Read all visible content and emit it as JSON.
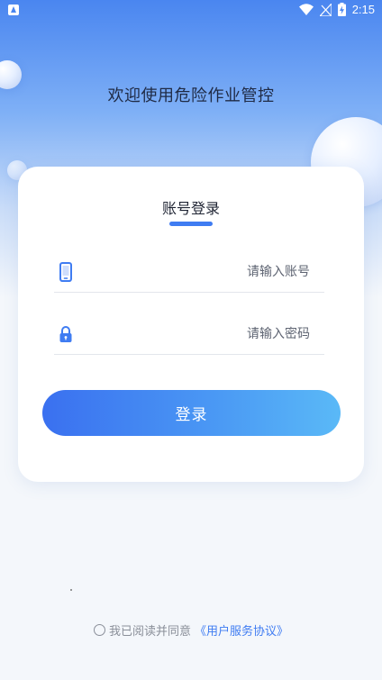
{
  "status_bar": {
    "time": "2:15",
    "icons": [
      "app-notification-icon",
      "wifi-icon",
      "signal-icon",
      "battery-charging-icon"
    ]
  },
  "welcome_text": "欢迎使用危险作业管控",
  "card": {
    "title": "账号登录"
  },
  "form": {
    "account": {
      "placeholder": "请输入账号",
      "icon": "phone-icon"
    },
    "password": {
      "placeholder": "请输入密码",
      "icon": "lock-icon"
    },
    "login_label": "登录"
  },
  "agreement": {
    "text": "我已阅读并同意",
    "link": "《用户服务协议》",
    "checked": false
  },
  "colors": {
    "accent": "#3f7cf2",
    "button_gradient_start": "#3a70f0",
    "button_gradient_end": "#5ab9f7",
    "background": "#f4f7fb"
  }
}
